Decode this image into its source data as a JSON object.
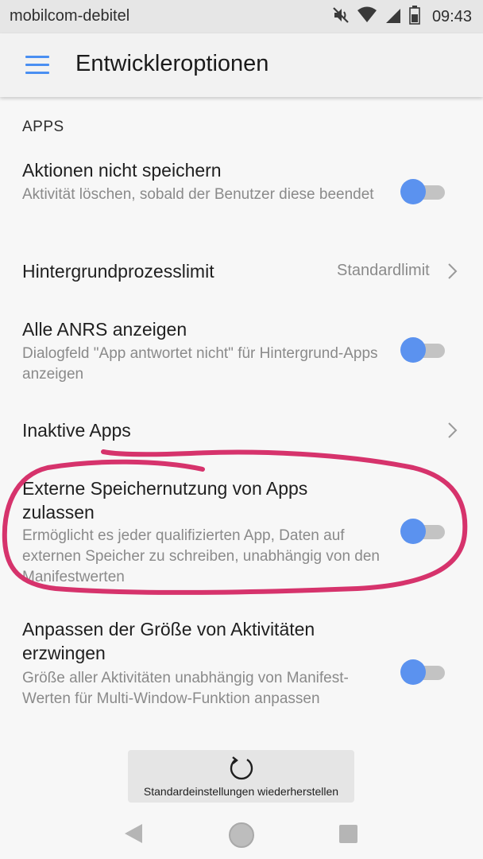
{
  "status_bar": {
    "carrier": "mobilcom-debitel",
    "time": "09:43",
    "icons": [
      "mute-icon",
      "wifi-icon",
      "signal-icon",
      "battery-icon"
    ]
  },
  "app_bar": {
    "menu_icon": "hamburger-menu-icon",
    "title": "Entwickleroptionen"
  },
  "section": {
    "header": "APPS"
  },
  "settings": [
    {
      "title": "Aktionen nicht speichern",
      "subtitle": "Aktivität löschen, sobald der Benutzer diese beendet",
      "control": "toggle",
      "enabled": true
    },
    {
      "title": "Hintergrundprozesslimit",
      "value": "Standardlimit",
      "control": "chevron"
    },
    {
      "title": "Alle ANRS anzeigen",
      "subtitle": "Dialogfeld \"App antwortet nicht\" für Hintergrund-Apps anzeigen",
      "control": "toggle",
      "enabled": true
    },
    {
      "title": "Inaktive Apps",
      "control": "chevron"
    },
    {
      "title": "Externe Speichernutzung von Apps zulassen",
      "subtitle": "Ermöglicht es jeder qualifizierten App, Daten auf externen Speicher zu schreiben, unabhängig von den Manifestwerten",
      "control": "toggle",
      "enabled": true,
      "annotated": true
    },
    {
      "title": "Anpassen der Größe von Aktivitäten erzwingen",
      "subtitle": "Größe aller Aktivitäten unabhängig von Manifest-Werten für Multi-Window-Funktion anpassen",
      "control": "toggle",
      "enabled": true
    }
  ],
  "reset_button": {
    "icon": "reset-icon",
    "label": "Standardeinstellungen wiederherstellen"
  },
  "nav_bar": {
    "icons": [
      "back-icon",
      "home-icon",
      "recents-icon"
    ]
  },
  "colors": {
    "accent": "#4a8ff2",
    "toggle_thumb": "#5b92ef",
    "toggle_track": "#c3c3c3",
    "annotation": "#d6336c",
    "background": "#f7f7f7",
    "app_bar": "#f2f2f2",
    "status_bar": "#e6e6e6"
  }
}
